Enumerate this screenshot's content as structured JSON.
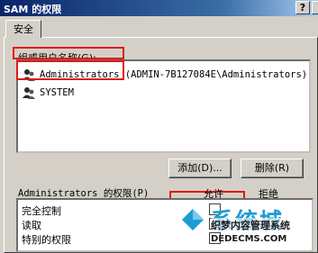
{
  "window": {
    "title": "SAM 的权限",
    "help_label": "?"
  },
  "tabs": [
    {
      "label": "安全"
    }
  ],
  "users_group": {
    "label": "组或用户名称(G):",
    "items": [
      {
        "name": "Administrators (ADMIN-7B127084E\\Administrators)",
        "icon": "user-group-icon"
      },
      {
        "name": "SYSTEM",
        "icon": "user-group-icon"
      }
    ]
  },
  "buttons": {
    "add_label": "添加(D)...",
    "remove_label": "删除(R)"
  },
  "permissions": {
    "header_label": "Administrators 的权限(P)",
    "allow_label": "允许",
    "deny_label": "拒绝",
    "rows": [
      {
        "label": "完全控制"
      },
      {
        "label": "读取"
      },
      {
        "label": "特别的权限"
      }
    ]
  },
  "watermark": {
    "main": "系统城",
    "sub": "织梦内容管理系统",
    "url": "DEDECMS.COM"
  },
  "colors": {
    "highlight": "#e01818",
    "title_bar": "#0a246a",
    "watermark_blue": "#1f9bd4"
  }
}
